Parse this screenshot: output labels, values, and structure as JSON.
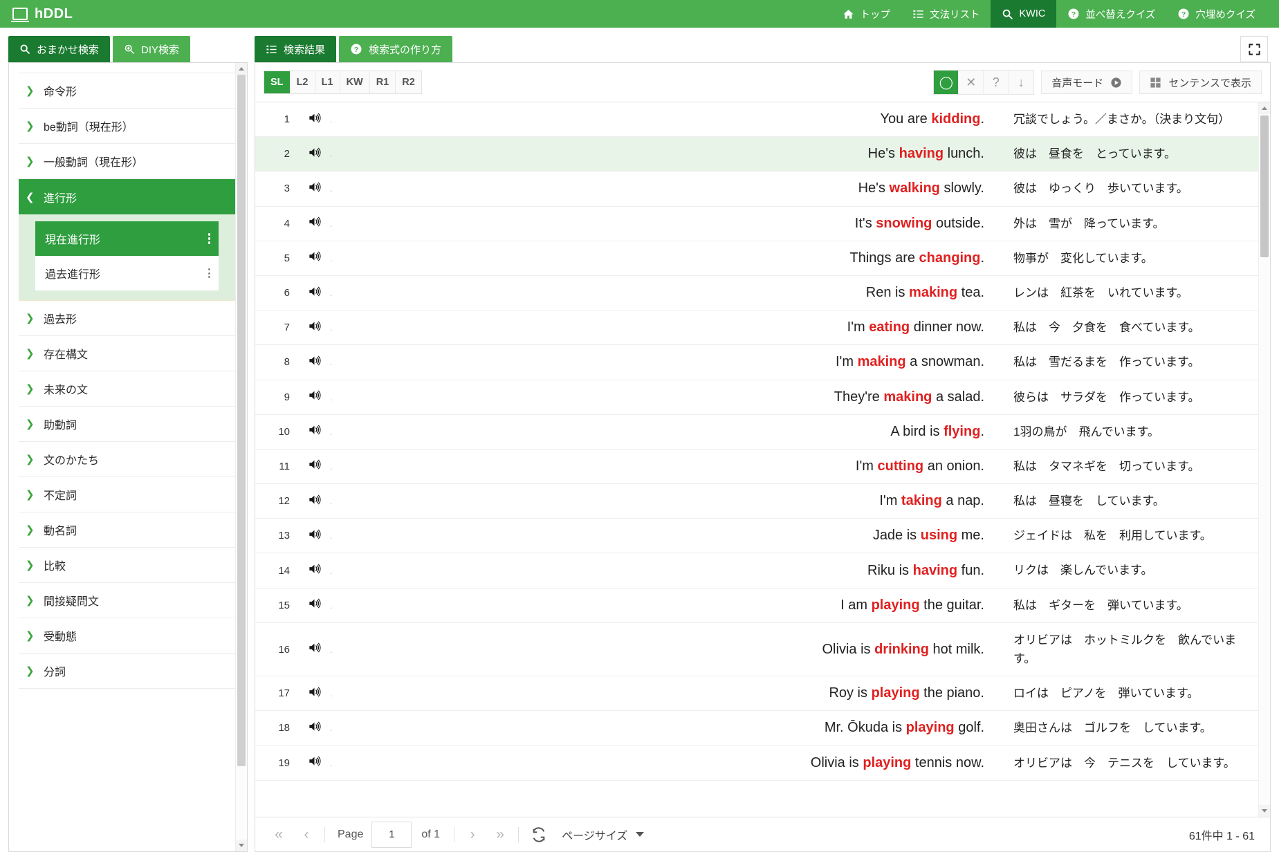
{
  "app": {
    "brand": "hDDL",
    "logo_icon": "laptop-icon"
  },
  "topnav": [
    {
      "label": "トップ",
      "icon": "home-icon",
      "active": false
    },
    {
      "label": "文法リスト",
      "icon": "list-icon",
      "active": false
    },
    {
      "label": "KWIC",
      "icon": "search-icon",
      "active": true
    },
    {
      "label": "並べ替えクイズ",
      "icon": "question-circle-icon",
      "active": false
    },
    {
      "label": "穴埋めクイズ",
      "icon": "question-circle-icon",
      "active": false
    }
  ],
  "left": {
    "tabs": [
      {
        "label": "おまかせ検索",
        "icon": "search-icon",
        "active": true
      },
      {
        "label": "DIY検索",
        "icon": "search-plus-icon",
        "active": false
      }
    ],
    "tree": [
      {
        "label": "命令形",
        "state": "collapsed"
      },
      {
        "label": "be動詞（現在形）",
        "state": "collapsed"
      },
      {
        "label": "一般動詞（現在形）",
        "state": "collapsed"
      },
      {
        "label": "進行形",
        "state": "expanded",
        "children": [
          {
            "label": "現在進行形",
            "selected": true
          },
          {
            "label": "過去進行形",
            "selected": false
          }
        ]
      },
      {
        "label": "過去形",
        "state": "collapsed"
      },
      {
        "label": "存在構文",
        "state": "collapsed"
      },
      {
        "label": "未来の文",
        "state": "collapsed"
      },
      {
        "label": "助動詞",
        "state": "collapsed"
      },
      {
        "label": "文のかたち",
        "state": "collapsed"
      },
      {
        "label": "不定詞",
        "state": "collapsed"
      },
      {
        "label": "動名詞",
        "state": "collapsed"
      },
      {
        "label": "比較",
        "state": "collapsed"
      },
      {
        "label": "間接疑問文",
        "state": "collapsed"
      },
      {
        "label": "受動態",
        "state": "collapsed"
      },
      {
        "label": "分詞",
        "state": "collapsed"
      }
    ]
  },
  "right": {
    "tabs": [
      {
        "label": "検索結果",
        "icon": "list-icon",
        "active": true
      },
      {
        "label": "検索式の作り方",
        "icon": "question-circle-icon",
        "active": false
      }
    ],
    "fullscreen_icon": "expand-icon",
    "sort_segments": [
      {
        "label": "SL",
        "active": true
      },
      {
        "label": "L2",
        "active": false
      },
      {
        "label": "L1",
        "active": false
      },
      {
        "label": "KW",
        "active": false
      },
      {
        "label": "R1",
        "active": false
      },
      {
        "label": "R2",
        "active": false
      }
    ],
    "icon_buttons": [
      {
        "name": "circle-icon",
        "glyph": "◯",
        "active": true
      },
      {
        "name": "close-icon",
        "glyph": "✕",
        "active": false
      },
      {
        "name": "question-icon",
        "glyph": "?",
        "active": false
      },
      {
        "name": "arrow-down-icon",
        "glyph": "↓",
        "active": false
      }
    ],
    "audio_mode_label": "音声モード",
    "audio_mode_icon": "play-circle-icon",
    "sentence_view_label": "センテンスで表示",
    "sentence_view_icon": "grid-icon"
  },
  "results": {
    "speaker_icon": "speaker-icon",
    "rows": [
      {
        "n": "1",
        "pre": "You are ",
        "kw": "kidding",
        "post": ".",
        "ja": "冗談でしょう。／まさか。（決まり文句）",
        "hl": false
      },
      {
        "n": "2",
        "pre": "He's ",
        "kw": "having",
        "post": " lunch.",
        "ja": "彼は　昼食を　とっています。",
        "hl": true
      },
      {
        "n": "3",
        "pre": "He's ",
        "kw": "walking",
        "post": " slowly.",
        "ja": "彼は　ゆっくり　歩いています。",
        "hl": false
      },
      {
        "n": "4",
        "pre": "It's ",
        "kw": "snowing",
        "post": " outside.",
        "ja": "外は　雪が　降っています。",
        "hl": false
      },
      {
        "n": "5",
        "pre": "Things are ",
        "kw": "changing",
        "post": ".",
        "ja": "物事が　変化しています。",
        "hl": false
      },
      {
        "n": "6",
        "pre": "Ren is ",
        "kw": "making",
        "post": " tea.",
        "ja": "レンは　紅茶を　いれています。",
        "hl": false
      },
      {
        "n": "7",
        "pre": "I'm ",
        "kw": "eating",
        "post": " dinner now.",
        "ja": "私は　今　夕食を　食べています。",
        "hl": false
      },
      {
        "n": "8",
        "pre": "I'm ",
        "kw": "making",
        "post": " a snowman.",
        "ja": "私は　雪だるまを　作っています。",
        "hl": false
      },
      {
        "n": "9",
        "pre": "They're ",
        "kw": "making",
        "post": " a salad.",
        "ja": "彼らは　サラダを　作っています。",
        "hl": false
      },
      {
        "n": "10",
        "pre": "A bird is ",
        "kw": "flying",
        "post": ".",
        "ja": "1羽の鳥が　飛んでいます。",
        "hl": false
      },
      {
        "n": "11",
        "pre": "I'm ",
        "kw": "cutting",
        "post": " an onion.",
        "ja": "私は　タマネギを　切っています。",
        "hl": false
      },
      {
        "n": "12",
        "pre": "I'm ",
        "kw": "taking",
        "post": " a nap.",
        "ja": "私は　昼寝を　しています。",
        "hl": false
      },
      {
        "n": "13",
        "pre": "Jade is ",
        "kw": "using",
        "post": " me.",
        "ja": "ジェイドは　私を　利用しています。",
        "hl": false
      },
      {
        "n": "14",
        "pre": "Riku is ",
        "kw": "having",
        "post": " fun.",
        "ja": "リクは　楽しんでいます。",
        "hl": false
      },
      {
        "n": "15",
        "pre": "I am ",
        "kw": "playing",
        "post": " the guitar.",
        "ja": "私は　ギターを　弾いています。",
        "hl": false
      },
      {
        "n": "16",
        "pre": "Olivia is ",
        "kw": "drinking",
        "post": " hot milk.",
        "ja": "オリビアは　ホットミルクを　飲んでいます。",
        "hl": false
      },
      {
        "n": "17",
        "pre": "Roy is ",
        "kw": "playing",
        "post": " the piano.",
        "ja": "ロイは　ピアノを　弾いています。",
        "hl": false
      },
      {
        "n": "18",
        "pre": "Mr. Ōkuda is ",
        "kw": "playing",
        "post": " golf.",
        "ja": "奥田さんは　ゴルフを　しています。",
        "hl": false
      },
      {
        "n": "19",
        "pre": "Olivia is ",
        "kw": "playing",
        "post": " tennis now.",
        "ja": "オリビアは　今　テニスを　しています。",
        "hl": false
      }
    ]
  },
  "pager": {
    "first_icon": "double-chevron-left-icon",
    "prev_icon": "chevron-left-icon",
    "page_label": "Page",
    "page_value": "1",
    "of_label": "of 1",
    "next_icon": "chevron-right-icon",
    "last_icon": "double-chevron-right-icon",
    "refresh_icon": "refresh-icon",
    "page_size_label": "ページサイズ",
    "count_label": "61件中 1 - 61"
  },
  "colors": {
    "brand_green": "#4caf50",
    "dark_green": "#1a7a30",
    "node_green": "#2e9e3f",
    "keyword_red": "#e02020",
    "row_highlight": "#e8f4e8"
  }
}
